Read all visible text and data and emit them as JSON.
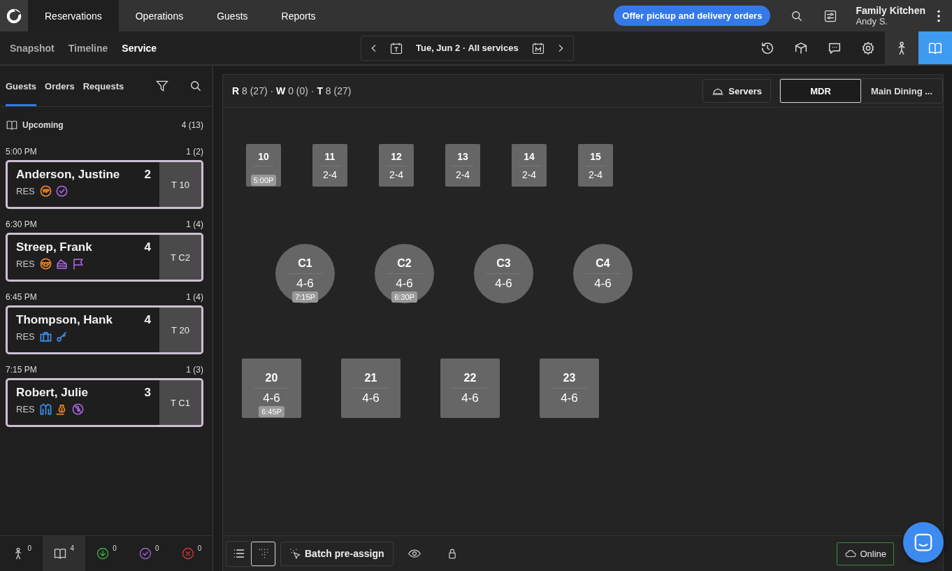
{
  "nav": {
    "tabs": [
      {
        "label": "Reservations",
        "selected": true
      },
      {
        "label": "Operations",
        "selected": false
      },
      {
        "label": "Guests",
        "selected": false
      },
      {
        "label": "Reports",
        "selected": false
      }
    ]
  },
  "promo": "Offer pickup and delivery orders",
  "account": {
    "name": "Family Kitchen",
    "user": "Andy S."
  },
  "subnav": [
    {
      "label": "Snapshot",
      "selected": false
    },
    {
      "label": "Timeline",
      "selected": false
    },
    {
      "label": "Service",
      "selected": true
    }
  ],
  "date": {
    "text": "Tue, Jun 2 · All services"
  },
  "tools": [
    {
      "kind": "history",
      "selected": false
    },
    {
      "kind": "box",
      "selected": false
    },
    {
      "kind": "chat",
      "selected": false
    },
    {
      "kind": "settings",
      "selected": false
    },
    {
      "kind": "person",
      "selected": false
    },
    {
      "kind": "book",
      "selected": true
    }
  ],
  "sidebar": {
    "tabs": [
      {
        "label": "Guests",
        "selected": true
      },
      {
        "label": "Orders",
        "selected": false
      },
      {
        "label": "Requests",
        "selected": false
      }
    ],
    "section": {
      "label": "Upcoming",
      "count": "4 (13)"
    },
    "groups": [
      {
        "time": "5:00 PM",
        "count": "1 (2)",
        "guests": [
          {
            "name": "Anderson, Justine",
            "party": "2",
            "type": "RES",
            "table": "T 10",
            "tags": [
              {
                "kind": "vip",
                "color": "#e8822a"
              },
              {
                "kind": "check",
                "color": "#a35fd8"
              }
            ]
          }
        ]
      },
      {
        "time": "6:30 PM",
        "count": "1 (4)",
        "guests": [
          {
            "name": "Streep, Frank",
            "party": "4",
            "type": "RES",
            "table": "T C2",
            "tags": [
              {
                "kind": "sunglasses",
                "color": "#e8822a"
              },
              {
                "kind": "cake",
                "color": "#a35fd8"
              },
              {
                "kind": "flag",
                "color": "#a35fd8"
              }
            ]
          }
        ]
      },
      {
        "time": "6:45 PM",
        "count": "1 (4)",
        "guests": [
          {
            "name": "Thompson, Hank",
            "party": "4",
            "type": "RES",
            "table": "T 20",
            "tags": [
              {
                "kind": "briefcase",
                "color": "#3c8ee8"
              },
              {
                "kind": "key",
                "color": "#3c8ee8"
              }
            ]
          }
        ]
      },
      {
        "time": "7:15 PM",
        "count": "1 (3)",
        "guests": [
          {
            "name": "Robert, Julie",
            "party": "3",
            "type": "RES",
            "table": "T C1",
            "tags": [
              {
                "kind": "jacket",
                "color": "#3c8ee8"
              },
              {
                "kind": "money",
                "color": "#e8822a"
              },
              {
                "kind": "nopeanut",
                "color": "#a35fd8"
              }
            ]
          }
        ]
      }
    ],
    "footer": [
      {
        "kind": "person",
        "count": "0",
        "selected": false,
        "color": "#cfcfcf"
      },
      {
        "kind": "book",
        "count": "4",
        "selected": true,
        "color": "#cfcfcf"
      },
      {
        "kind": "arrived",
        "count": "0",
        "selected": false,
        "color": "#3fae49"
      },
      {
        "kind": "done",
        "count": "0",
        "selected": false,
        "color": "#a35fd8"
      },
      {
        "kind": "cancel",
        "count": "0",
        "selected": false,
        "color": "#d03a3a"
      }
    ]
  },
  "floor": {
    "stats": "**R** 8 (27) · **W** 0 (0) · **T** 8 (27)",
    "servers": "Servers",
    "sections": [
      {
        "label": "MDR",
        "selected": true
      },
      {
        "label": "Main Dining ...",
        "selected": false
      }
    ],
    "rows": [
      [
        {
          "kind": "small",
          "name": "10",
          "time": "5:00P"
        },
        {
          "kind": "small",
          "name": "11",
          "capacity": "2-4"
        },
        {
          "kind": "small",
          "name": "12",
          "capacity": "2-4"
        },
        {
          "kind": "small",
          "name": "13",
          "capacity": "2-4"
        },
        {
          "kind": "small",
          "name": "14",
          "capacity": "2-4"
        },
        {
          "kind": "small",
          "name": "15",
          "capacity": "2-4"
        }
      ],
      [
        {
          "kind": "round",
          "name": "C1",
          "capacity": "4-6",
          "time": "7:15P"
        },
        {
          "kind": "round",
          "name": "C2",
          "capacity": "4-6",
          "time": "6:30P"
        },
        {
          "kind": "round",
          "name": "C3",
          "capacity": "4-6"
        },
        {
          "kind": "round",
          "name": "C4",
          "capacity": "4-6"
        }
      ],
      [
        {
          "kind": "square",
          "name": "20",
          "capacity": "4-6",
          "time": "6:45P"
        },
        {
          "kind": "square",
          "name": "21",
          "capacity": "4-6"
        },
        {
          "kind": "square",
          "name": "22",
          "capacity": "4-6"
        },
        {
          "kind": "square",
          "name": "23",
          "capacity": "4-6"
        }
      ]
    ]
  },
  "toolbar": {
    "views": [
      {
        "kind": "list",
        "selected": false
      },
      {
        "kind": "grid",
        "selected": true
      }
    ],
    "batch": "Batch pre-assign",
    "status": "Online"
  }
}
